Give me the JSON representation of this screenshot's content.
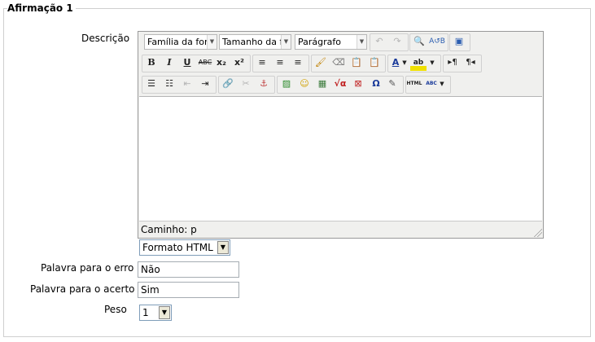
{
  "fieldset": {
    "legend": "Afirmação 1"
  },
  "description": {
    "label": "Descrição",
    "toolbar": {
      "font_family": "Família da font",
      "font_size": "Tamanho da fo",
      "paragraph": "Parágrafo",
      "bold": "B",
      "italic": "I",
      "underline": "U",
      "strike": "ABC",
      "subscript": "x₂",
      "superscript": "x²",
      "font_color": "A",
      "highlight": "ab",
      "omega": "Ω",
      "html": "HTML",
      "spell": "ABC"
    },
    "path_label": "Caminho: p"
  },
  "format": {
    "selected": "Formato HTML"
  },
  "wrong_word": {
    "label": "Palavra para o erro",
    "value": "Não"
  },
  "right_word": {
    "label": "Palavra para o acerto",
    "value": "Sim"
  },
  "weight": {
    "label": "Peso",
    "selected": "1"
  }
}
